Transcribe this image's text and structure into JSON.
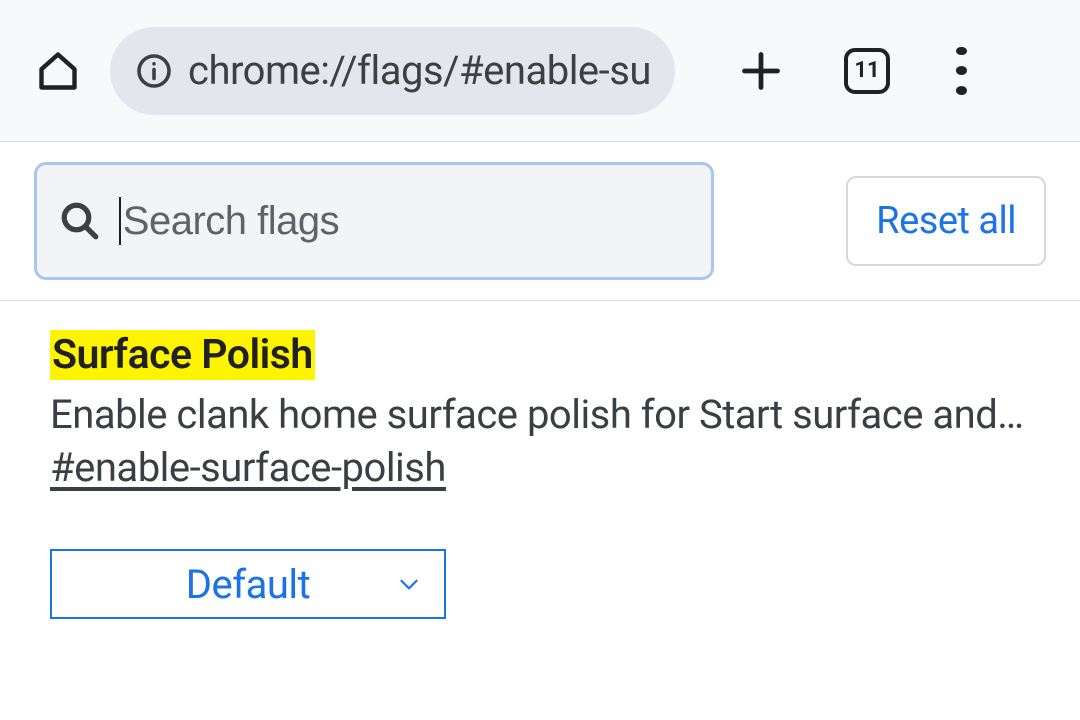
{
  "browser": {
    "url": "chrome://flags/#enable-sur",
    "tab_count": "11"
  },
  "search": {
    "placeholder": "Search flags",
    "reset_label": "Reset all"
  },
  "flag": {
    "title": "Surface Polish",
    "description": "Enable clank home surface polish for Start surface and N…",
    "anchor": "#enable-surface-polish",
    "selected_value": "Default"
  }
}
